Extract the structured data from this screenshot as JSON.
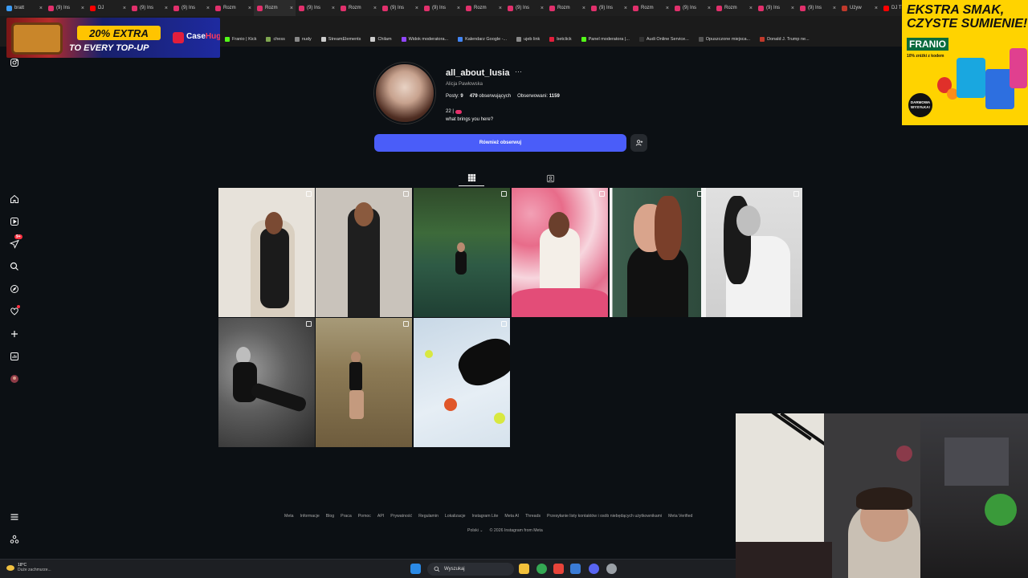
{
  "browser": {
    "tabs": [
      {
        "label": "bratt",
        "color": "#3c9cf5"
      },
      {
        "label": "(9) Ins",
        "color": "#e1306c"
      },
      {
        "label": "DJ",
        "color": "#ff0000"
      },
      {
        "label": "(9) Ins",
        "color": "#e1306c"
      },
      {
        "label": "(9) Ins",
        "color": "#e1306c"
      },
      {
        "label": "Rozm",
        "color": "#e1306c"
      },
      {
        "label": "Rozm",
        "color": "#e1306c"
      },
      {
        "label": "(9) Ins",
        "color": "#e1306c"
      },
      {
        "label": "Rozm",
        "color": "#e1306c"
      },
      {
        "label": "(9) Ins",
        "color": "#e1306c"
      },
      {
        "label": "(9) Ins",
        "color": "#e1306c"
      },
      {
        "label": "Rozm",
        "color": "#e1306c"
      },
      {
        "label": "(9) Ins",
        "color": "#e1306c"
      },
      {
        "label": "Rozm",
        "color": "#e1306c"
      },
      {
        "label": "(9) Ins",
        "color": "#e1306c"
      },
      {
        "label": "Rozm",
        "color": "#e1306c"
      },
      {
        "label": "(9) Ins",
        "color": "#e1306c"
      },
      {
        "label": "Rozm",
        "color": "#e1306c"
      },
      {
        "label": "(9) Ins",
        "color": "#e1306c"
      },
      {
        "label": "(9) Ins",
        "color": "#e1306c"
      },
      {
        "label": "Używ",
        "color": "#c0392b"
      },
      {
        "label": "DJ Th",
        "color": "#ff0000"
      }
    ],
    "bookmarks": [
      {
        "label": "Franio | Kick",
        "color": "#53fc18"
      },
      {
        "label": "chess",
        "color": "#7fa650"
      },
      {
        "label": "nudy",
        "color": "#888888"
      },
      {
        "label": "StreamElements",
        "color": "#cccccc"
      },
      {
        "label": "Chilam",
        "color": "#cccccc"
      },
      {
        "label": "Widok moderatora...",
        "color": "#9146ff"
      },
      {
        "label": "Kalendarz Google -...",
        "color": "#4285f4"
      },
      {
        "label": "ujeb link",
        "color": "#888888"
      },
      {
        "label": "betclick",
        "color": "#e21e3c"
      },
      {
        "label": "Panel moderatora |...",
        "color": "#53fc18"
      },
      {
        "label": "Audi Online Service...",
        "color": "#333333"
      },
      {
        "label": "Opuszczone miejsca...",
        "color": "#555555"
      },
      {
        "label": "Donald J. Trump ne...",
        "color": "#c0392b"
      }
    ]
  },
  "ads": {
    "left": {
      "badge": "20% EXTRA",
      "subtitle": "TO EVERY TOP-UP",
      "brand_a": "Case",
      "brand_b": "Hug"
    },
    "right": {
      "line1": "EKSTRA SMAK,",
      "line2": "CZYSTE SUMIENIE!",
      "brand": "FRANIO",
      "small": "10% zniżki z kodem",
      "badge": "DARMOWA WYSYŁKA!"
    }
  },
  "profile": {
    "username": "all_about_lusia",
    "full_name": "Alicja Pawłowska",
    "posts_label": "Posty:",
    "posts_count": "9",
    "following_count": "479",
    "following_label": "obserwujących",
    "followers_label": "Obserwowani:",
    "followers_count": "1159",
    "bio_line1": "22 |",
    "bio_line2": "what brings you here?",
    "follow_button": "Również obserwuj"
  },
  "footer": {
    "links": [
      "Meta",
      "Informacje",
      "Blog",
      "Praca",
      "Pomoc",
      "API",
      "Prywatność",
      "Regulamin",
      "Lokalizacje",
      "Instagram Lite",
      "Meta AI",
      "Threads",
      "Przesyłanie listy kontaktów i osób niebędących użytkownikami",
      "Meta Verified"
    ],
    "language": "Polski",
    "copyright": "© 2026 Instagram from Meta"
  },
  "sidebar": {
    "notifications_badge": "9+"
  },
  "taskbar": {
    "temp": "18°C",
    "weather": "Duże zachmurze...",
    "search_placeholder": "Wyszukaj"
  }
}
